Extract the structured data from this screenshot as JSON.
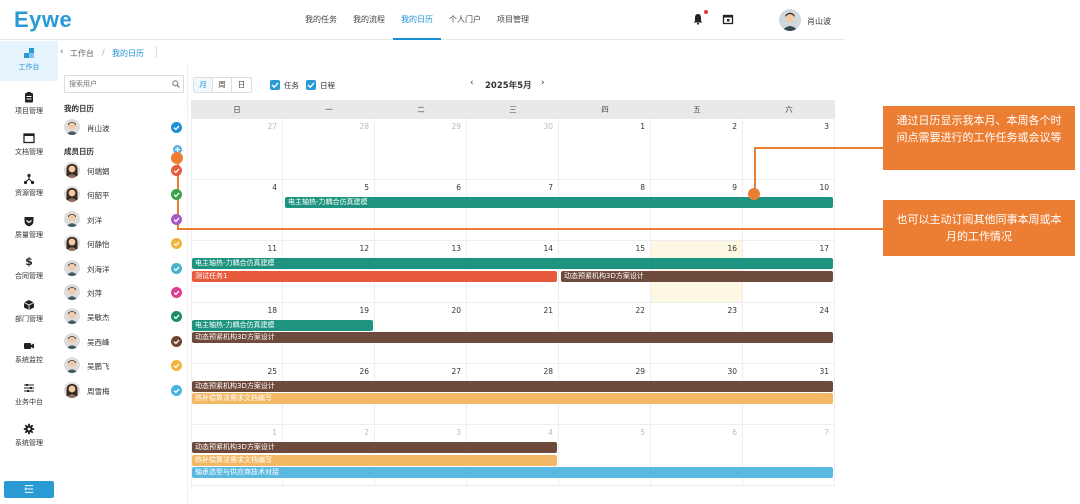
{
  "app": {
    "logo": "Eywe"
  },
  "topnav": [
    {
      "label": "我的任务",
      "active": false
    },
    {
      "label": "我的流程",
      "active": false
    },
    {
      "label": "我的日历",
      "active": true
    },
    {
      "label": "个人门户",
      "active": false
    },
    {
      "label": "项目管理",
      "active": false
    }
  ],
  "user": {
    "name": "肖山波"
  },
  "sidebar": {
    "items": [
      {
        "label": "工作台",
        "icon": "workbench-icon",
        "active": true
      },
      {
        "label": "项目管理",
        "icon": "clipboard-icon"
      },
      {
        "label": "文档管理",
        "icon": "folder-icon"
      },
      {
        "label": "资源管理",
        "icon": "share-icon"
      },
      {
        "label": "质量管理",
        "icon": "shield-icon"
      },
      {
        "label": "合同管理",
        "icon": "dollar-icon"
      },
      {
        "label": "部门管理",
        "icon": "cube-icon"
      },
      {
        "label": "系统监控",
        "icon": "video-icon"
      },
      {
        "label": "业务中台",
        "icon": "sliders-icon"
      },
      {
        "label": "系统管理",
        "icon": "gear-icon"
      }
    ]
  },
  "breadcrumb": {
    "root": "工作台",
    "current": "我的日历"
  },
  "userpanel": {
    "search_placeholder": "搜索用户",
    "my_calendar_title": "我的日历",
    "me": {
      "name": "肖山波",
      "color": "#1e8fd6"
    },
    "members_title": "成员日历",
    "members": [
      {
        "name": "何端娟",
        "color": "#e85a3c"
      },
      {
        "name": "何韶平",
        "color": "#3aa34a"
      },
      {
        "name": "刘洋",
        "color": "#a558c8"
      },
      {
        "name": "何静怡",
        "color": "#f0b43c"
      },
      {
        "name": "刘海洋",
        "color": "#46b4c8"
      },
      {
        "name": "刘萍",
        "color": "#e03c8c"
      },
      {
        "name": "吴敏杰",
        "color": "#1e8c64"
      },
      {
        "name": "吴西峰",
        "color": "#6e4630"
      },
      {
        "name": "吴鹏飞",
        "color": "#f0b43c"
      },
      {
        "name": "周雪梅",
        "color": "#46b4e0"
      }
    ]
  },
  "toolbar": {
    "views": [
      "月",
      "周",
      "日"
    ],
    "active_view": "月",
    "filter_task": "任务",
    "filter_schedule": "日程",
    "month": "2025年5月"
  },
  "calendar": {
    "weekdays": [
      "日",
      "一",
      "二",
      "三",
      "四",
      "五",
      "六"
    ],
    "weeks": [
      [
        {
          "d": "27",
          "o": true
        },
        {
          "d": "28",
          "o": true
        },
        {
          "d": "29",
          "o": true
        },
        {
          "d": "30",
          "o": true
        },
        {
          "d": "1"
        },
        {
          "d": "2"
        },
        {
          "d": "3"
        }
      ],
      [
        {
          "d": "4"
        },
        {
          "d": "5"
        },
        {
          "d": "6"
        },
        {
          "d": "7"
        },
        {
          "d": "8"
        },
        {
          "d": "9"
        },
        {
          "d": "10"
        }
      ],
      [
        {
          "d": "11"
        },
        {
          "d": "12"
        },
        {
          "d": "13"
        },
        {
          "d": "14"
        },
        {
          "d": "15"
        },
        {
          "d": "16",
          "today": true
        },
        {
          "d": "17"
        }
      ],
      [
        {
          "d": "18"
        },
        {
          "d": "19"
        },
        {
          "d": "20"
        },
        {
          "d": "21"
        },
        {
          "d": "22"
        },
        {
          "d": "23"
        },
        {
          "d": "24"
        }
      ],
      [
        {
          "d": "25"
        },
        {
          "d": "26"
        },
        {
          "d": "27"
        },
        {
          "d": "28"
        },
        {
          "d": "29"
        },
        {
          "d": "30"
        },
        {
          "d": "31"
        }
      ],
      [
        {
          "d": "1",
          "o": true
        },
        {
          "d": "2",
          "o": true
        },
        {
          "d": "3",
          "o": true
        },
        {
          "d": "4",
          "o": true
        },
        {
          "d": "5",
          "o": true
        },
        {
          "d": "6",
          "o": true
        },
        {
          "d": "7",
          "o": true
        }
      ]
    ],
    "events": [
      {
        "title": "电主轴热-力耦合仿真建模",
        "week": 1,
        "start": 1,
        "end": 6,
        "lane": 0,
        "color": "#1e9480"
      },
      {
        "title": "电主轴热-力耦合仿真建模",
        "week": 2,
        "start": 0,
        "end": 6,
        "lane": 0,
        "color": "#1e9480"
      },
      {
        "title": "测试任务1",
        "week": 2,
        "start": 0,
        "end": 3,
        "lane": 1,
        "color": "#e85a3c"
      },
      {
        "title": "动态预紧机构3D方案设计",
        "week": 2,
        "start": 4,
        "end": 6,
        "lane": 1,
        "color": "#6e4a3c"
      },
      {
        "title": "电主轴热-力耦合仿真建模",
        "week": 3,
        "start": 0,
        "end": 1,
        "lane": 0,
        "color": "#1e9480"
      },
      {
        "title": "动态预紧机构3D方案设计",
        "week": 3,
        "start": 0,
        "end": 6,
        "lane": 1,
        "color": "#6e4a3c"
      },
      {
        "title": "动态预紧机构3D方案设计",
        "week": 4,
        "start": 0,
        "end": 6,
        "lane": 0,
        "color": "#6e4a3c"
      },
      {
        "title": "热补偿算法需求文档编写",
        "week": 4,
        "start": 0,
        "end": 6,
        "lane": 1,
        "color": "#f3b865"
      },
      {
        "title": "动态预紧机构3D方案设计",
        "week": 5,
        "start": 0,
        "end": 3,
        "lane": 0,
        "color": "#6e4a3c"
      },
      {
        "title": "热补偿算法需求文档编写",
        "week": 5,
        "start": 0,
        "end": 3,
        "lane": 1,
        "color": "#f3b865"
      },
      {
        "title": "轴承选型与供应商技术对接",
        "week": 5,
        "start": 0,
        "end": 6,
        "lane": 2,
        "color": "#5ab9e0"
      }
    ]
  },
  "annotations": [
    {
      "text": "通过日历显示我本月、本周各个时间点需要进行的工作任务或会议等"
    },
    {
      "text": "也可以主动订阅其他同事本周或本月的工作情况"
    }
  ],
  "colors": {
    "accent": "#1a8fd6",
    "annotation": "#ec7e34"
  }
}
